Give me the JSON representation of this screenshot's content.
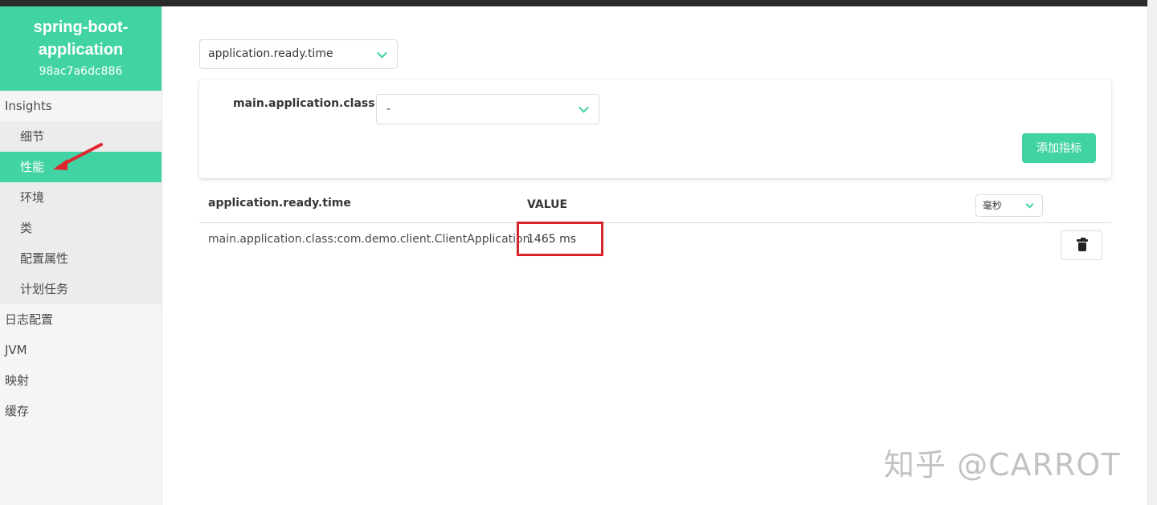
{
  "app": {
    "name": "spring-boot-application",
    "id": "98ac7a6dc886"
  },
  "sidebar": {
    "group_label": "Insights",
    "group_items": [
      {
        "label": "细节"
      },
      {
        "label": "性能",
        "active": true
      },
      {
        "label": "环境"
      },
      {
        "label": "类"
      },
      {
        "label": "配置属性"
      },
      {
        "label": "计划任务"
      }
    ],
    "top_items": [
      {
        "label": "日志配置"
      },
      {
        "label": "JVM"
      },
      {
        "label": "映射"
      },
      {
        "label": "缓存"
      }
    ]
  },
  "main": {
    "metric_select_value": "application.ready.time",
    "tag_label": "main.application.class",
    "tag_select_value": "-",
    "add_button_label": "添加指标",
    "table": {
      "metric_header": "application.ready.time",
      "value_header": "VALUE",
      "unit_select_value": "毫秒",
      "rows": [
        {
          "name": "main.application.class:com.demo.client.ClientApplication",
          "value": "1465 ms"
        }
      ]
    }
  },
  "watermark": "知乎 @CARROT",
  "colors": {
    "accent": "#42d3a5",
    "highlight": "#d9242b",
    "arrow": "#e0262e"
  },
  "icons": {
    "select_chevron": "chevron-down-icon",
    "delete": "trash-icon",
    "annotation": "red-arrow-icon"
  }
}
